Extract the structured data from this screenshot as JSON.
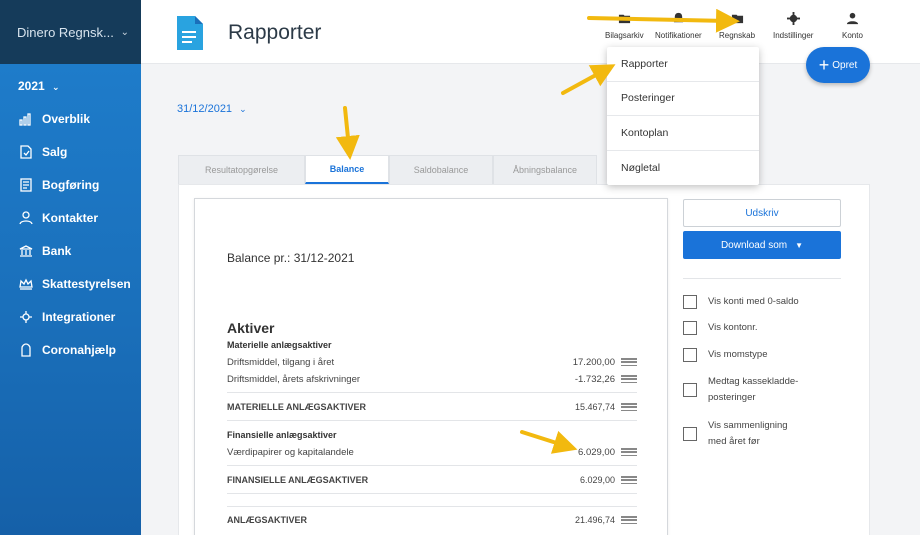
{
  "sidebar": {
    "org_name": "Dinero Regnsk...",
    "year": "2021",
    "items": [
      {
        "label": "Overblik",
        "icon": "bar-chart-icon"
      },
      {
        "label": "Salg",
        "icon": "sales-icon"
      },
      {
        "label": "Bogføring",
        "icon": "bookkeeping-icon"
      },
      {
        "label": "Kontakter",
        "icon": "contacts-icon"
      },
      {
        "label": "Bank",
        "icon": "bank-icon"
      },
      {
        "label": "Skattestyrelsen",
        "icon": "crown-icon"
      },
      {
        "label": "Integrationer",
        "icon": "integrations-icon"
      },
      {
        "label": "Coronahjælp",
        "icon": "corona-icon"
      }
    ]
  },
  "header": {
    "title": "Rapporter",
    "nav": {
      "bilagsarkiv": "Bilagsarkiv",
      "notifikationer": "Notifikationer",
      "regnskab": "Regnskab",
      "indstillinger": "Indstillinger",
      "konto": "Konto"
    },
    "create_label": "Opret"
  },
  "dropdown": {
    "items": [
      "Rapporter",
      "Posteringer",
      "Kontoplan",
      "Nøgletal"
    ]
  },
  "date_selector": "31/12/2021",
  "tabs": [
    "Resultatopgørelse",
    "Balance",
    "Saldobalance",
    "Åbningsbalance"
  ],
  "active_tab": "Balance",
  "report": {
    "title": "Balance pr.: 31/12-2021",
    "heading": "Aktiver",
    "group1": {
      "title": "Materielle anlægsaktiver",
      "rows": [
        {
          "label": "Driftsmiddel, tilgang i året",
          "value": "17.200,00"
        },
        {
          "label": "Driftsmiddel, årets afskrivninger",
          "value": "-1.732,26"
        }
      ],
      "total_label": "MATERIELLE ANLÆGSAKTIVER",
      "total_value": "15.467,74"
    },
    "group2": {
      "title": "Finansielle anlægsaktiver",
      "rows": [
        {
          "label": "Værdipapirer og kapitalandele",
          "value": "6.029,00"
        }
      ],
      "total_label": "FINANSIELLE ANLÆGSAKTIVER",
      "total_value": "6.029,00"
    },
    "grand_total_label": "ANLÆGSAKTIVER",
    "grand_total_value": "21.496,74"
  },
  "actions": {
    "print_label": "Udskriv",
    "download_label": "Download som"
  },
  "options": [
    "Vis konti med 0-saldo",
    "Vis kontonr.",
    "Vis momstype",
    "Medtag kassekladde-posteringer",
    "Vis sammenligning med året før"
  ],
  "colors": {
    "accent": "#1a73d9",
    "sidebar": "#1a6fba",
    "sidebar_header": "#153b5a",
    "arrow": "#f2b90f"
  }
}
